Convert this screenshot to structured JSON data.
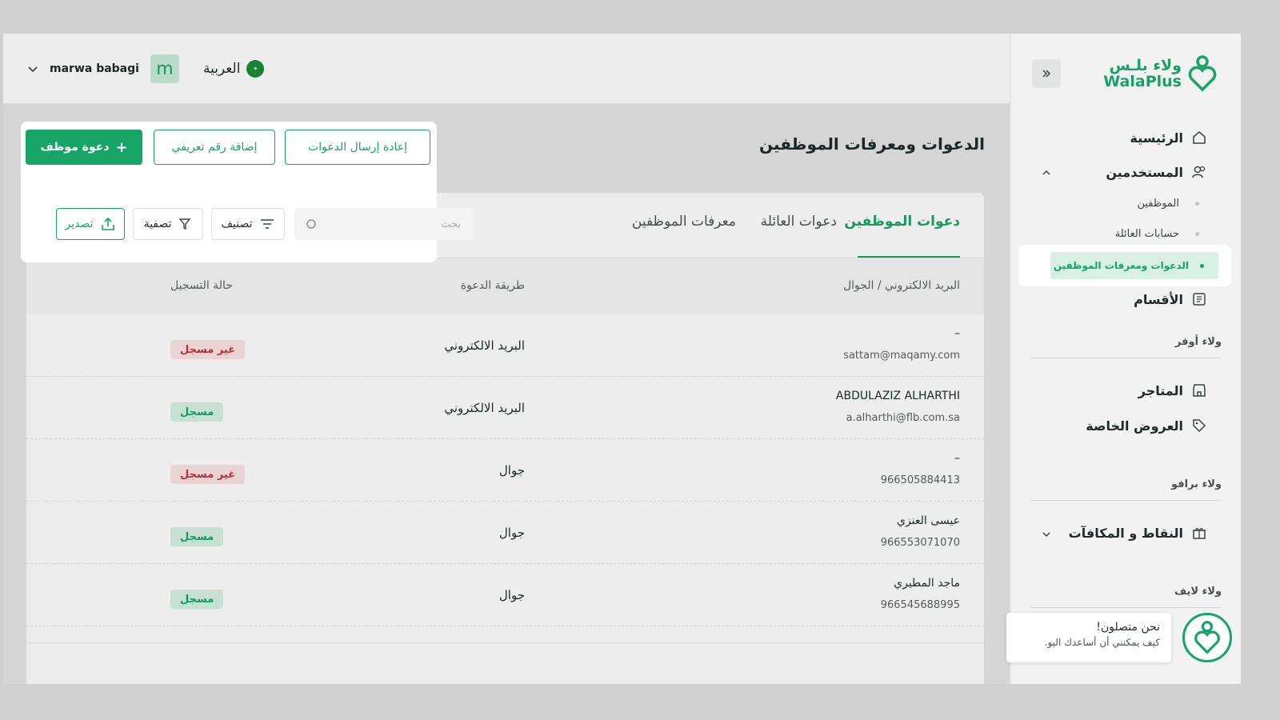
{
  "brand": {
    "name_ar": "ولاء بلـس",
    "name_en": "WalaPlus"
  },
  "topbar": {
    "user_name": "marwa babagi",
    "avatar_letter": "m",
    "language": "العربية",
    "flag_text": "السعودية"
  },
  "sidebar": {
    "nav": [
      {
        "label": "الرئيسية"
      },
      {
        "label": "المستخدمين"
      }
    ],
    "sub_items": [
      {
        "label": "الموظفين"
      },
      {
        "label": "حسابات العائلة"
      },
      {
        "label": "الدعوات ومعرفات الموظفين"
      }
    ],
    "departments": "الأقسام",
    "section_offers": "ولاء أوفر",
    "stores": "المتاجر",
    "special_offers": "العروض الخاصة",
    "section_bravo": "ولاء برافو",
    "points": "النقاط و المكافآت",
    "section_life": "ولاء لايف"
  },
  "page": {
    "title": "الدعوات ومعرفات الموظفين"
  },
  "actions": {
    "invite": "دعوة موظف",
    "add_id": "إضافة رقم تعريفي",
    "resend": "إعادة إرسال الدعوات"
  },
  "tabs": [
    {
      "label": "دعوات الموظفين"
    },
    {
      "label": "دعوات العائلة"
    },
    {
      "label": "معرفات الموظفين"
    }
  ],
  "toolbar": {
    "search_placeholder": "بحث",
    "sort": "تصنيف",
    "filter": "تصفية",
    "export": "تصدير"
  },
  "table": {
    "columns": [
      "البريد الالكتروني / الجوال",
      "طريقة الدعوة",
      "حالة التسجيل"
    ],
    "rows": [
      {
        "name": "–",
        "contact": "sattam@maqamy.com",
        "method": "البريد الالكتروني",
        "status": "غير مسجل",
        "registered": false
      },
      {
        "name": "ABDULAZIZ ALHARTHI",
        "contact": "a.alharthi@flb.com.sa",
        "method": "البريد الالكتروني",
        "status": "مسجل",
        "registered": true
      },
      {
        "name": "–",
        "contact": "966505884413",
        "method": "جوال",
        "status": "غير مسجل",
        "registered": false
      },
      {
        "name": "عيسى العنزي",
        "contact": "966553071070",
        "method": "جوال",
        "status": "مسجل",
        "registered": true
      },
      {
        "name": "ماجد المطيري",
        "contact": "966545688995",
        "method": "جوال",
        "status": "مسجل",
        "registered": true
      }
    ]
  },
  "chat": {
    "title": "نحن متصلون!",
    "subtitle": "كيف يمكنني أن أساعدك اليو."
  },
  "colors": {
    "accent": "#17a567",
    "danger": "#c93434"
  }
}
